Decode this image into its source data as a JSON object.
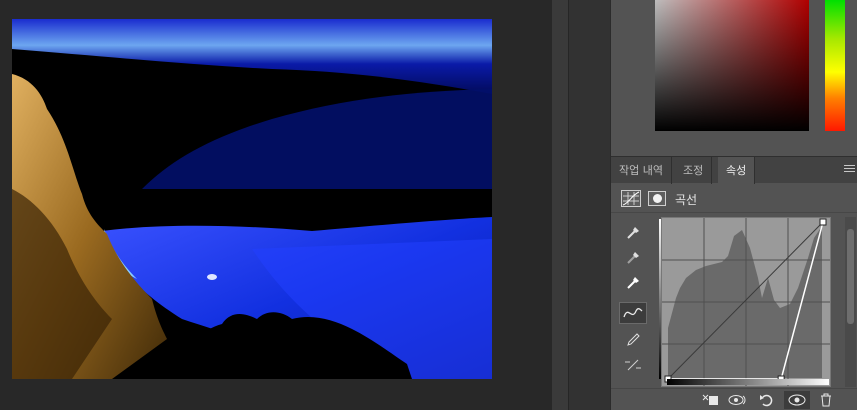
{
  "canvas": {
    "background": "#282828"
  },
  "panel": {
    "tabs": [
      {
        "label": "작업 내역",
        "active": false
      },
      {
        "label": "조정",
        "active": false
      },
      {
        "label": "속성",
        "active": true
      }
    ],
    "properties": {
      "title": "곡선",
      "tools": [
        "eyedropper-black-icon",
        "eyedropper-gray-icon",
        "eyedropper-white-icon",
        "curve-point-tool-icon",
        "pencil-icon",
        "smooth-icon"
      ],
      "curve": {
        "points": [
          [
            0,
            0
          ],
          [
            0.73,
            0
          ],
          [
            1,
            1
          ]
        ]
      },
      "footer_icons": [
        "clip-to-layer-icon",
        "view-previous-icon",
        "reset-icon",
        "visibility-eye-icon",
        "trash-icon"
      ]
    }
  },
  "colors": {
    "accent_red": "#b00000",
    "hue_green": "#00e000",
    "hue_red": "#ff1800"
  }
}
